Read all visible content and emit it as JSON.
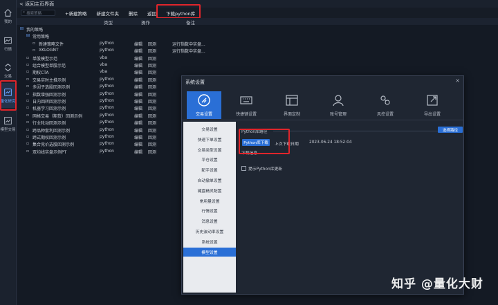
{
  "sidebar": {
    "items": [
      {
        "label": "我的",
        "icon": "home-icon"
      },
      {
        "label": "行情",
        "icon": "chart-icon"
      },
      {
        "label": "交易",
        "icon": "trade-arrows-icon"
      },
      {
        "label": "量化研究",
        "icon": "quant-research-icon",
        "active": true
      },
      {
        "label": "模型交易",
        "icon": "model-trade-icon"
      }
    ]
  },
  "topbar": {
    "back_label": "< 返回主页界面"
  },
  "toolbar": {
    "search_placeholder": "搜索策略",
    "buttons": [
      "+新建策略",
      "新建文件夹",
      "删除",
      "返回",
      "下载python库"
    ]
  },
  "columns": {
    "type": "类型",
    "op": "操作",
    "note": "备注"
  },
  "tree": [
    {
      "indent": 0,
      "label": "我的策略",
      "kind": "folder",
      "type": "",
      "ops": [],
      "note": ""
    },
    {
      "indent": 1,
      "label": "常用策略",
      "kind": "folder",
      "type": "",
      "ops": [],
      "note": ""
    },
    {
      "indent": 2,
      "label": "新建策略文件",
      "kind": "file",
      "type": "python",
      "ops": [
        "编辑",
        "回测"
      ],
      "note": "运行指数中实盘..."
    },
    {
      "indent": 2,
      "label": "XKLOGNT",
      "kind": "file",
      "type": "python",
      "ops": [
        "编辑",
        "回测"
      ],
      "note": "运行指数中实盘..."
    },
    {
      "indent": 1,
      "label": "单股模型示范",
      "kind": "file",
      "type": "vba",
      "ops": [
        "编辑",
        "回测"
      ],
      "note": ""
    },
    {
      "indent": 1,
      "label": "组合模型单股示范",
      "kind": "file",
      "type": "vba",
      "ops": [
        "编辑",
        "回测"
      ],
      "note": ""
    },
    {
      "indent": 1,
      "label": "期权CTA",
      "kind": "file",
      "type": "vba",
      "ops": [
        "编辑",
        "回测"
      ],
      "note": ""
    },
    {
      "indent": 1,
      "label": "交易实时主推示例",
      "kind": "file",
      "type": "python",
      "ops": [
        "编辑",
        "回测"
      ],
      "note": ""
    },
    {
      "indent": 1,
      "label": "多因子选股回测示例",
      "kind": "file",
      "type": "python",
      "ops": [
        "编辑",
        "回测"
      ],
      "note": ""
    },
    {
      "indent": 1,
      "label": "指数增强回测示例",
      "kind": "file",
      "type": "python",
      "ops": [
        "编辑",
        "回测"
      ],
      "note": ""
    },
    {
      "indent": 1,
      "label": "日内回转回测示例",
      "kind": "file",
      "type": "python",
      "ops": [
        "编辑",
        "回测"
      ],
      "note": ""
    },
    {
      "indent": 1,
      "label": "机器学习回测示例",
      "kind": "file",
      "type": "python",
      "ops": [
        "编辑",
        "回测"
      ],
      "note": ""
    },
    {
      "indent": 1,
      "label": "网格交易（期货）回测示例",
      "kind": "file",
      "type": "python",
      "ops": [
        "编辑",
        "回测"
      ],
      "note": ""
    },
    {
      "indent": 1,
      "label": "行业轮动回测示例",
      "kind": "file",
      "type": "python",
      "ops": [
        "编辑",
        "回测"
      ],
      "note": ""
    },
    {
      "indent": 1,
      "label": "跨品种套利回测示例",
      "kind": "file",
      "type": "python",
      "ops": [
        "编辑",
        "回测"
      ],
      "note": ""
    },
    {
      "indent": 1,
      "label": "跨式期权回测示例",
      "kind": "file",
      "type": "python",
      "ops": [
        "编辑",
        "回测"
      ],
      "note": ""
    },
    {
      "indent": 1,
      "label": "集合竞价选股回测示例",
      "kind": "file",
      "type": "python",
      "ops": [
        "编辑",
        "回测"
      ],
      "note": ""
    },
    {
      "indent": 1,
      "label": "双均线实盘示例PT",
      "kind": "file",
      "type": "python",
      "ops": [
        "编辑",
        "回测"
      ],
      "note": ""
    }
  ],
  "dialog": {
    "title": "系统设置",
    "close": "×",
    "tabs": [
      {
        "label": "交易设置",
        "icon": "trade-settings-icon",
        "active": true
      },
      {
        "label": "快捷键设置",
        "icon": "keyboard-icon"
      },
      {
        "label": "界面定制",
        "icon": "layout-icon"
      },
      {
        "label": "账号管理",
        "icon": "user-icon"
      },
      {
        "label": "风控设置",
        "icon": "risk-control-icon"
      },
      {
        "label": "导出设置",
        "icon": "export-icon"
      }
    ],
    "nav": [
      "交易设置",
      "快速下单设置",
      "交易类型设置",
      "平仓设置",
      "配手设置",
      "自动撤单设置",
      "键盘精灵配置",
      "常用量设置",
      "行情设置",
      "消息设置",
      "历史波动率设置",
      "系统设置",
      "模型设置"
    ],
    "nav_active_index": 12,
    "python_path_label": "Python库路径",
    "choose_path_btn": "选择路径",
    "download_btn": "Python库下载",
    "last_download_label": "上次下载日期",
    "last_download_value": "2023-06-24 18:52:04",
    "download_info_label": "下载信息",
    "checkbox_label": "提示Python库更新"
  },
  "watermark": "知乎 @量化大财"
}
